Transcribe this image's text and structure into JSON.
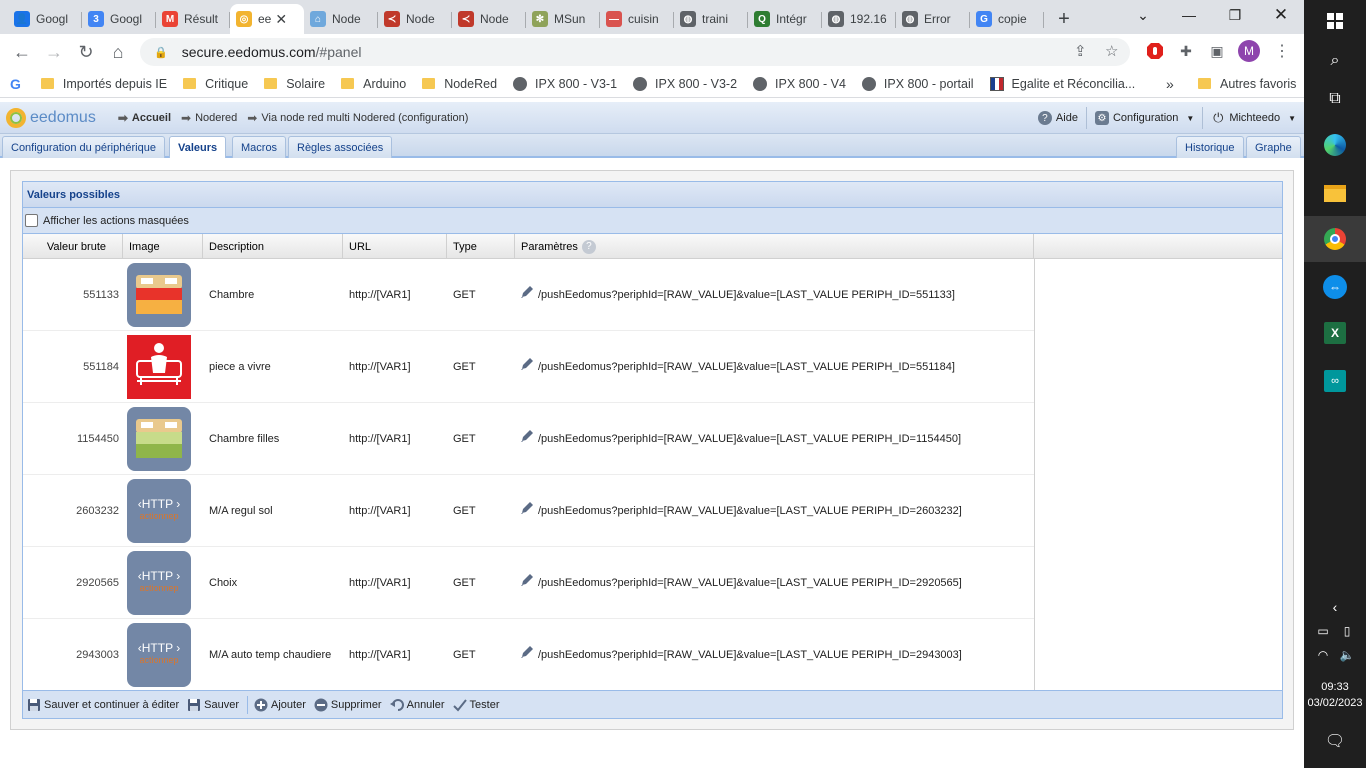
{
  "browser": {
    "tabs": [
      {
        "title": "Googl",
        "color": "#1a73e8",
        "glyph": "👤"
      },
      {
        "title": "Googl",
        "color": "#4285f4",
        "glyph": "3"
      },
      {
        "title": "Résult",
        "color": "#ea4335",
        "glyph": "M"
      },
      {
        "title": "ee",
        "color": "#f2b430",
        "glyph": "◎",
        "active": true
      },
      {
        "title": "Node",
        "color": "#6fa8dc",
        "glyph": "⌂"
      },
      {
        "title": "Node",
        "color": "#c0392b",
        "glyph": "≺"
      },
      {
        "title": "Node",
        "color": "#c0392b",
        "glyph": "≺"
      },
      {
        "title": "MSun",
        "color": "#8fa35a",
        "glyph": "✻"
      },
      {
        "title": "cuisin",
        "color": "#d9534f",
        "glyph": "—"
      },
      {
        "title": "traini",
        "color": "#5f6368",
        "glyph": "◍"
      },
      {
        "title": "Intégr",
        "color": "#2e7d32",
        "glyph": "Q"
      },
      {
        "title": "192.16",
        "color": "#5f6368",
        "glyph": "◍"
      },
      {
        "title": "Error",
        "color": "#5f6368",
        "glyph": "◍"
      },
      {
        "title": "copie",
        "color": "#4285f4",
        "glyph": "G"
      }
    ],
    "new_tab": "+",
    "url_host": "secure.eedomus.com",
    "url_path": "/#panel",
    "profile_initial": "M"
  },
  "bookmarks": [
    {
      "label": "Importés depuis IE",
      "kind": "folder"
    },
    {
      "label": "Critique",
      "kind": "folder"
    },
    {
      "label": "Solaire",
      "kind": "folder"
    },
    {
      "label": "Arduino",
      "kind": "folder"
    },
    {
      "label": "NodeRed",
      "kind": "folder"
    },
    {
      "label": "IPX 800 - V3-1",
      "kind": "globe"
    },
    {
      "label": "IPX 800 - V3-2",
      "kind": "globe"
    },
    {
      "label": "IPX 800 - V4",
      "kind": "globe"
    },
    {
      "label": "IPX 800 - portail",
      "kind": "globe"
    },
    {
      "label": "Egalite et Réconcilia...",
      "kind": "flag"
    }
  ],
  "bookmarks_more": "»",
  "bookmarks_other": "Autres favoris",
  "eedomus": {
    "logo": "eedomus",
    "breadcrumb": [
      "Accueil",
      "Nodered",
      "Via node red multi Nodered (configuration)"
    ],
    "help": "Aide",
    "configuration": "Configuration",
    "user": "Michteedo",
    "tabs": [
      "Configuration du périphérique",
      "Valeurs",
      "Macros",
      "Règles associées"
    ],
    "right_tabs": [
      "Historique",
      "Graphe"
    ],
    "panel_title": "Valeurs possibles",
    "show_hidden": "Afficher les actions masquées",
    "columns": [
      "Valeur brute",
      "Image",
      "Description",
      "URL",
      "Type",
      "Paramètres"
    ],
    "rows": [
      {
        "raw": "551133",
        "image": "bed-red-icon",
        "description": "Chambre",
        "url": "http://[VAR1]",
        "type": "GET",
        "params": "/pushEedomus?periphId=[RAW_VALUE]&value=[LAST_VALUE PERIPH_ID=551133]"
      },
      {
        "raw": "551184",
        "image": "sofa-icon",
        "description": "piece a vivre",
        "url": "http://[VAR1]",
        "type": "GET",
        "params": "/pushEedomus?periphId=[RAW_VALUE]&value=[LAST_VALUE PERIPH_ID=551184]"
      },
      {
        "raw": "1154450",
        "image": "bed-green-icon",
        "description": "Chambre filles",
        "url": "http://[VAR1]",
        "type": "GET",
        "params": "/pushEedomus?periphId=[RAW_VALUE]&value=[LAST_VALUE PERIPH_ID=1154450]"
      },
      {
        "raw": "2603232",
        "image": "http-icon",
        "description": "M/A regul sol",
        "url": "http://[VAR1]",
        "type": "GET",
        "params": "/pushEedomus?periphId=[RAW_VALUE]&value=[LAST_VALUE PERIPH_ID=2603232]"
      },
      {
        "raw": "2920565",
        "image": "http-icon",
        "description": "Choix",
        "url": "http://[VAR1]",
        "type": "GET",
        "params": "/pushEedomus?periphId=[RAW_VALUE]&value=[LAST_VALUE PERIPH_ID=2920565]"
      },
      {
        "raw": "2943003",
        "image": "http-icon",
        "description": "M/A auto temp chaudiere",
        "url": "http://[VAR1]",
        "type": "GET",
        "params": "/pushEedomus?periphId=[RAW_VALUE]&value=[LAST_VALUE PERIPH_ID=2943003]"
      }
    ],
    "http_label": "‹HTTP ›",
    "http_sub": "actionnep",
    "footer": [
      "Sauver et continuer à éditer",
      "Sauver",
      "Ajouter",
      "Supprimer",
      "Annuler",
      "Tester"
    ]
  },
  "taskbar": {
    "time": "09:33",
    "date": "03/02/2023"
  }
}
